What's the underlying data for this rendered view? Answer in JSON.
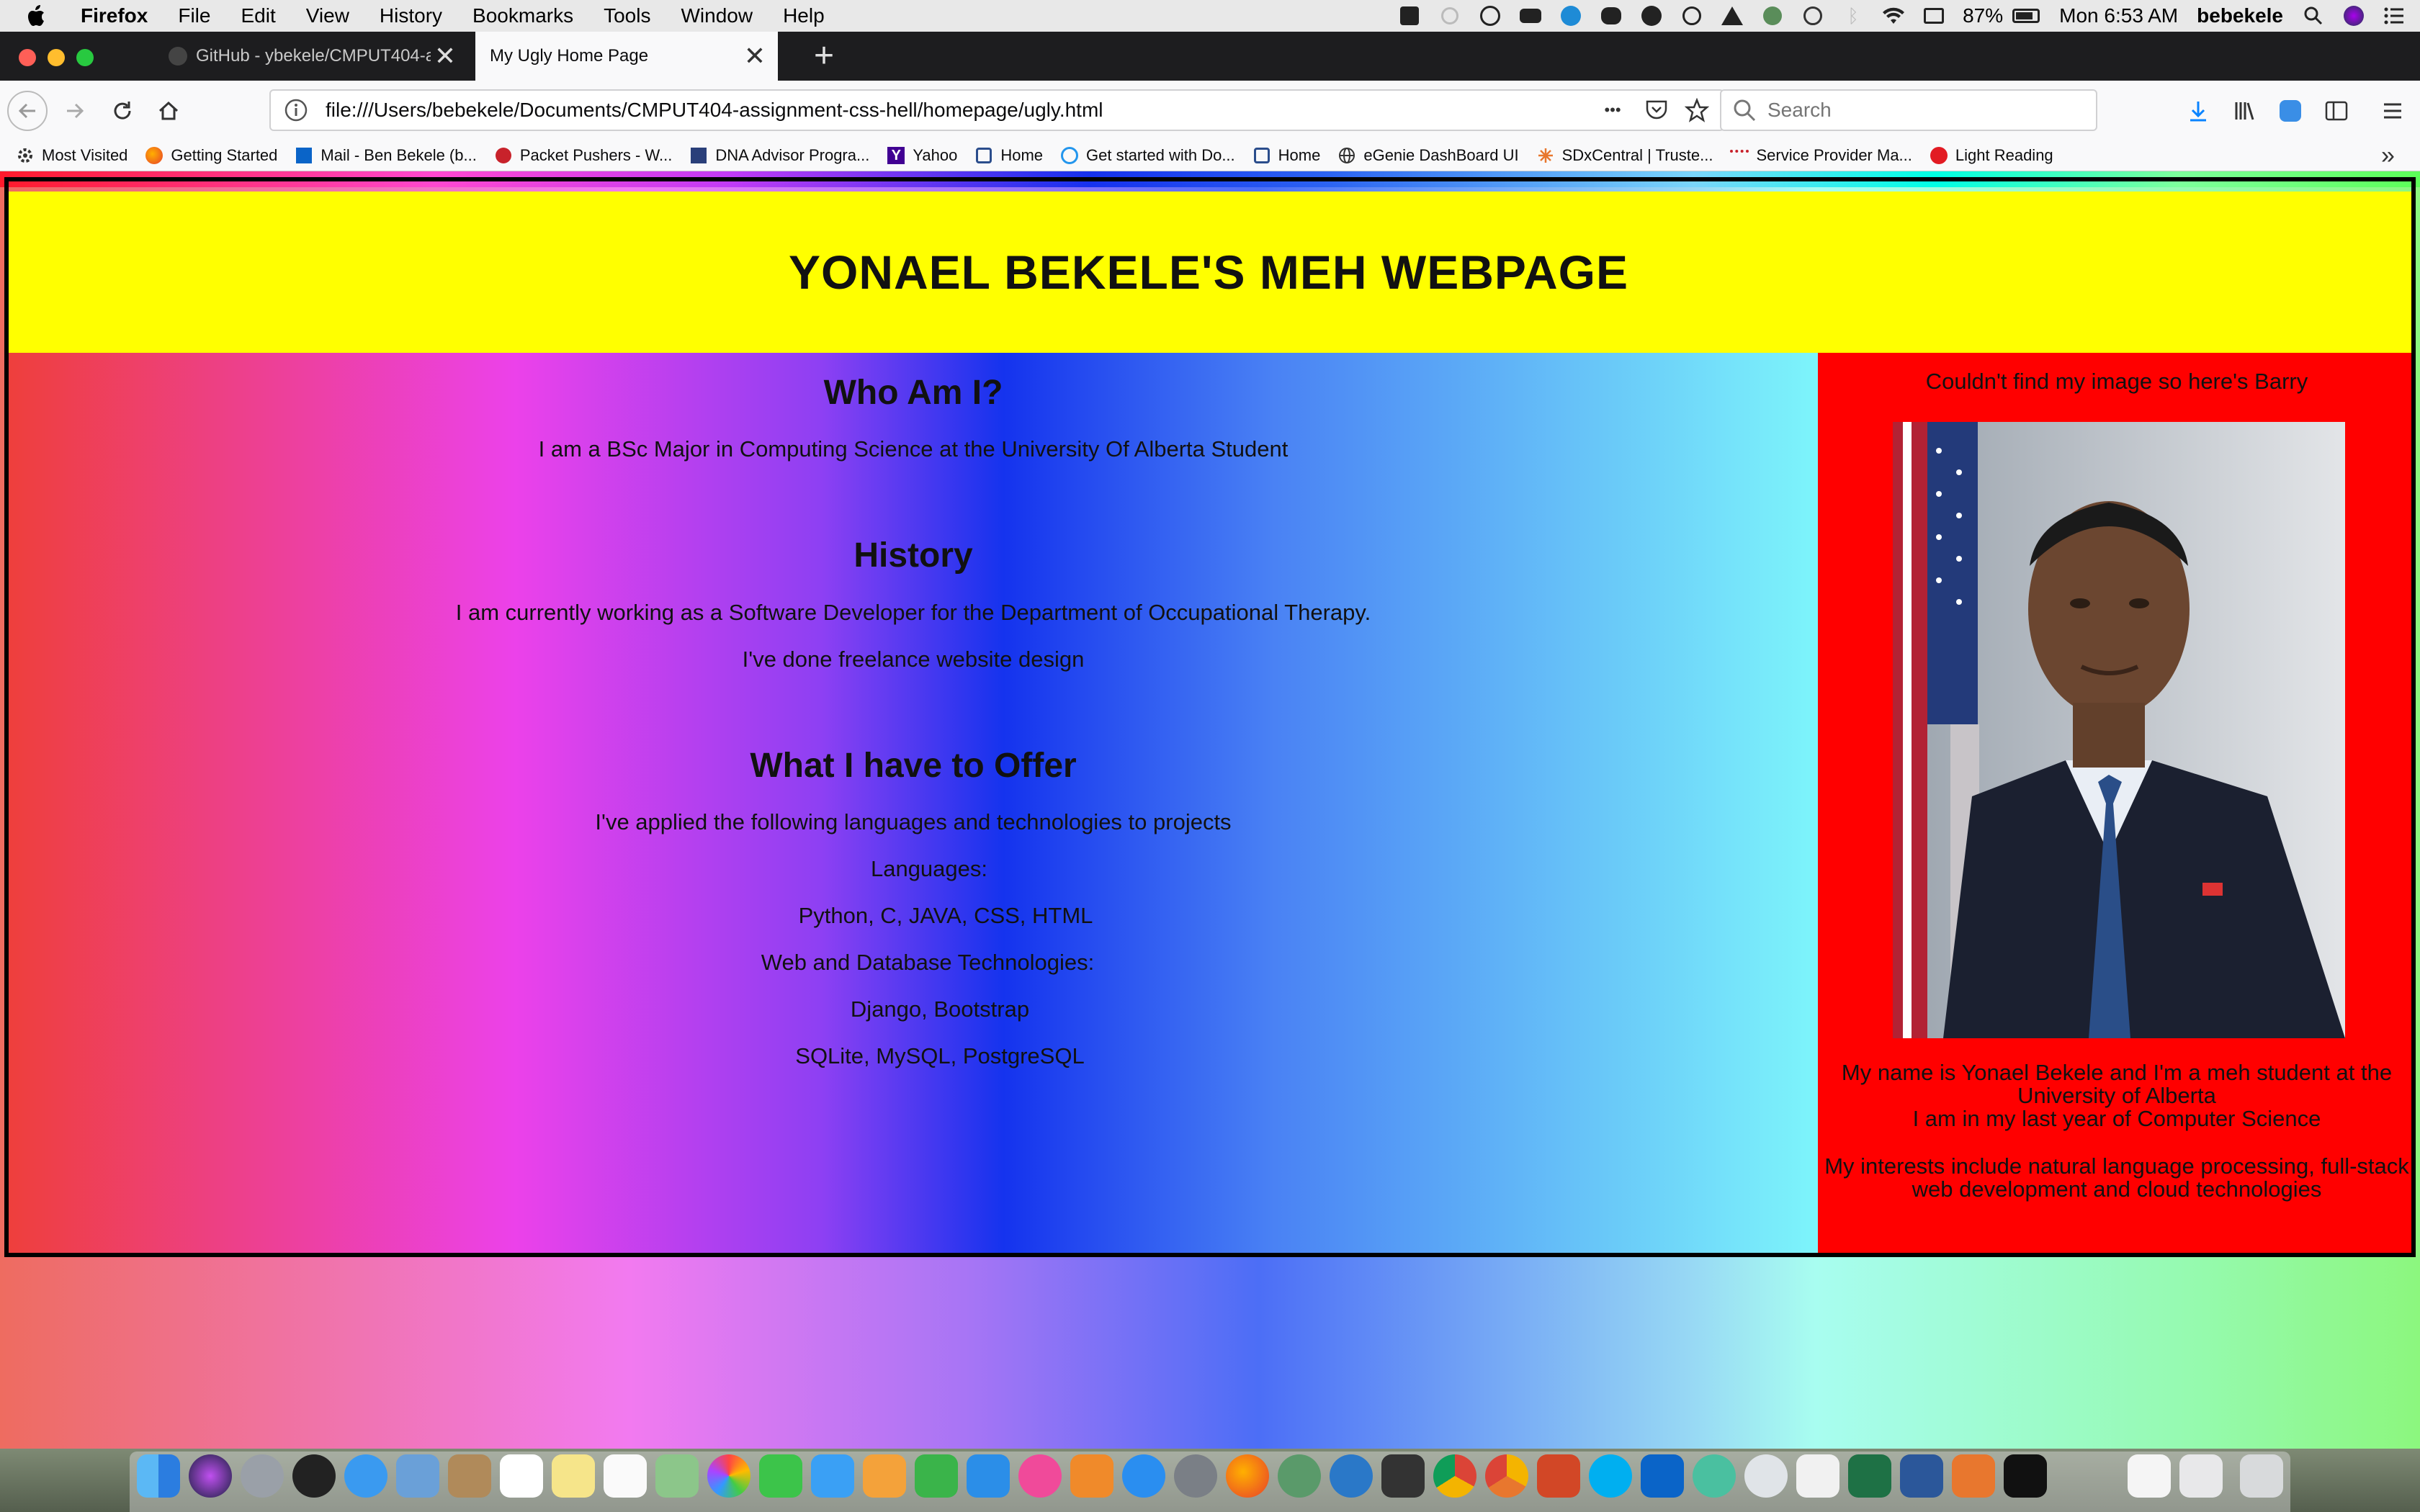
{
  "menubar": {
    "app_name": "Firefox",
    "items": [
      "File",
      "Edit",
      "View",
      "History",
      "Bookmarks",
      "Tools",
      "Window",
      "Help"
    ],
    "battery": "87%",
    "clock": "Mon 6:53 AM",
    "user": "bebekele"
  },
  "tabs": {
    "inactive_label": "GitHub - ybekele/CMPUT404-a",
    "active_label": "My Ugly Home Page",
    "close_glyph": "✕",
    "new_tab_glyph": "+"
  },
  "nav": {
    "url": "file:///Users/bebekele/Documents/CMPUT404-assignment-css-hell/homepage/ugly.html",
    "more_glyph": "•••",
    "search_placeholder": "Search"
  },
  "bookmarks": [
    {
      "label": "Most Visited",
      "icon": "gear-icon"
    },
    {
      "label": "Getting Started",
      "icon": "firefox-icon"
    },
    {
      "label": "Mail - Ben Bekele (b...",
      "icon": "outlook-icon"
    },
    {
      "label": "Packet Pushers - W...",
      "icon": "packet-pushers-icon"
    },
    {
      "label": "DNA Advisor Progra...",
      "icon": "dna-icon"
    },
    {
      "label": "Yahoo",
      "icon": "yahoo-icon"
    },
    {
      "label": "Home",
      "icon": "home-icon"
    },
    {
      "label": "Get started with Do...",
      "icon": "docker-icon"
    },
    {
      "label": "Home",
      "icon": "home-icon"
    },
    {
      "label": "eGenie DashBoard UI",
      "icon": "globe-icon"
    },
    {
      "label": "SDxCentral | Truste...",
      "icon": "sdx-icon"
    },
    {
      "label": "Service Provider Ma...",
      "icon": "cisco-icon"
    },
    {
      "label": "Light Reading",
      "icon": "light-reading-icon"
    }
  ],
  "page": {
    "title": "YONAEL BEKELE'S MEH WEBPAGE",
    "who_heading": "Who Am I?",
    "who_text": "I am a BSc Major in Computing Science at the University Of Alberta Student",
    "history_heading": "History",
    "history_text1": "I am currently working as a Software Developer for the Department of Occupational Therapy.",
    "history_text2": "I've done freelance website design",
    "offer_heading": "What I have to Offer",
    "offer_intro": "I've applied the following languages and technologies to projects",
    "languages_label": "Languages:",
    "languages": "Python, C, JAVA, CSS, HTML",
    "web_label": "Web and Database Technologies:",
    "web1": "Django, Bootstrap",
    "web2": "SQLite, MySQL, PostgreSQL",
    "aside_caption": "Couldn't find my image so here's Barry",
    "aside_bio": "My name is Yonael Bekele and I'm a meh student at the University of Alberta",
    "aside_year": "I am in my last year of Computer Science",
    "aside_interests": "My interests include natural language processing, full-stack web development and cloud technologies"
  }
}
